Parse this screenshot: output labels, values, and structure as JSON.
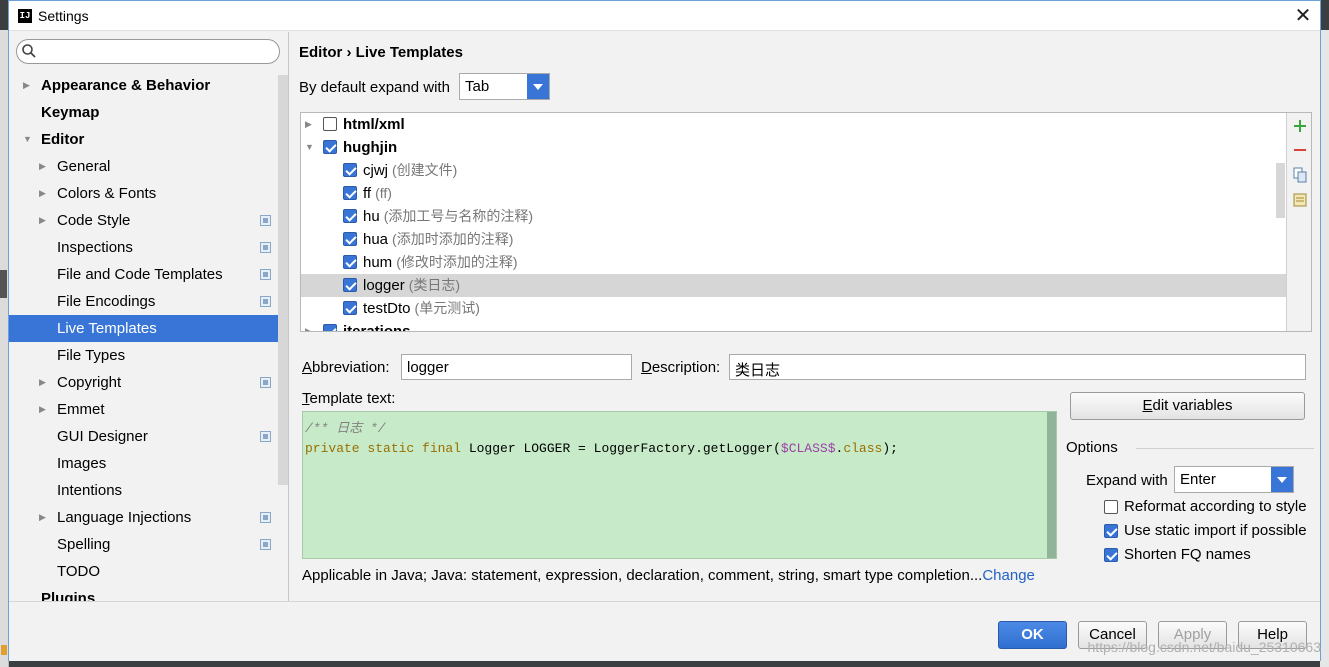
{
  "window": {
    "title": "Settings"
  },
  "search": {
    "placeholder": ""
  },
  "sidebar": {
    "items": [
      {
        "label": "Appearance & Behavior",
        "bold": true,
        "arrow": "right",
        "level": 0
      },
      {
        "label": "Keymap",
        "bold": true,
        "arrow": "",
        "level": 0
      },
      {
        "label": "Editor",
        "bold": true,
        "arrow": "down",
        "level": 0
      },
      {
        "label": "General",
        "arrow": "right",
        "level": 1
      },
      {
        "label": "Colors & Fonts",
        "arrow": "right",
        "level": 1
      },
      {
        "label": "Code Style",
        "arrow": "right",
        "level": 1,
        "project_icon": true
      },
      {
        "label": "Inspections",
        "arrow": "",
        "level": 1,
        "project_icon": true
      },
      {
        "label": "File and Code Templates",
        "arrow": "",
        "level": 1,
        "project_icon": true
      },
      {
        "label": "File Encodings",
        "arrow": "",
        "level": 1,
        "project_icon": true
      },
      {
        "label": "Live Templates",
        "arrow": "",
        "level": 1,
        "selected": true
      },
      {
        "label": "File Types",
        "arrow": "",
        "level": 1
      },
      {
        "label": "Copyright",
        "arrow": "right",
        "level": 1,
        "project_icon": true
      },
      {
        "label": "Emmet",
        "arrow": "right",
        "level": 1
      },
      {
        "label": "GUI Designer",
        "arrow": "",
        "level": 1,
        "project_icon": true
      },
      {
        "label": "Images",
        "arrow": "",
        "level": 1
      },
      {
        "label": "Intentions",
        "arrow": "",
        "level": 1
      },
      {
        "label": "Language Injections",
        "arrow": "right",
        "level": 1,
        "project_icon": true
      },
      {
        "label": "Spelling",
        "arrow": "",
        "level": 1,
        "project_icon": true
      },
      {
        "label": "TODO",
        "arrow": "",
        "level": 1
      },
      {
        "label": "Plugins",
        "bold": true,
        "arrow": "",
        "level": 0
      }
    ]
  },
  "main": {
    "breadcrumb": "Editor › Live Templates",
    "expand_label": "By default expand with",
    "expand_value": "Tab",
    "templates": [
      {
        "name": "html/xml",
        "desc": "",
        "group": true,
        "arrow": "right",
        "checked": false
      },
      {
        "name": "hughjin",
        "desc": "",
        "group": true,
        "arrow": "down",
        "checked": true
      },
      {
        "name": "cjwj",
        "desc": "(创建文件)",
        "checked": true
      },
      {
        "name": "ff",
        "desc": "(ff)",
        "checked": true
      },
      {
        "name": "hu",
        "desc": "(添加工号与名称的注释)",
        "checked": true
      },
      {
        "name": "hua",
        "desc": "(添加时添加的注释)",
        "checked": true
      },
      {
        "name": "hum",
        "desc": "(修改时添加的注释)",
        "checked": true
      },
      {
        "name": "logger",
        "desc": "(类日志)",
        "checked": true,
        "selected": true
      },
      {
        "name": "testDto",
        "desc": "(单元测试)",
        "checked": true
      },
      {
        "name": "iterations",
        "desc": "",
        "group": true,
        "arrow": "right",
        "checked": true
      }
    ],
    "abbreviation_label": "Abbreviation:",
    "abbreviation_value": "logger",
    "description_label": "Description:",
    "description_value": "类日志",
    "template_text_label": "Template text:",
    "code_line1": "/** 日志 */",
    "code_line2_kw": "private static final",
    "code_line2_mid": " Logger LOGGER = LoggerFactory.getLogger(",
    "code_line2_var": "$CLASS$",
    "code_line2_dot": ".",
    "code_line2_class": "class",
    "code_line2_end": ");",
    "edit_variables": "Edit variables",
    "options_title": "Options",
    "expand_with_label": "Expand with",
    "expand_with_value": "Enter",
    "opt_reformat": "Reformat according to style",
    "opt_static": "Use static import if possible",
    "opt_fq": "Shorten FQ names",
    "applicable_text": "Applicable in Java; Java: statement, expression, declaration, comment, string, smart type completion...",
    "change_link": "Change"
  },
  "buttons": {
    "ok": "OK",
    "cancel": "Cancel",
    "apply": "Apply",
    "help": "Help"
  },
  "watermark": "https://blog.csdn.net/baidu_25310663",
  "colors": {
    "selection": "#3875d7",
    "editor_bg": "#c7ebc9",
    "link": "#2462c7"
  }
}
